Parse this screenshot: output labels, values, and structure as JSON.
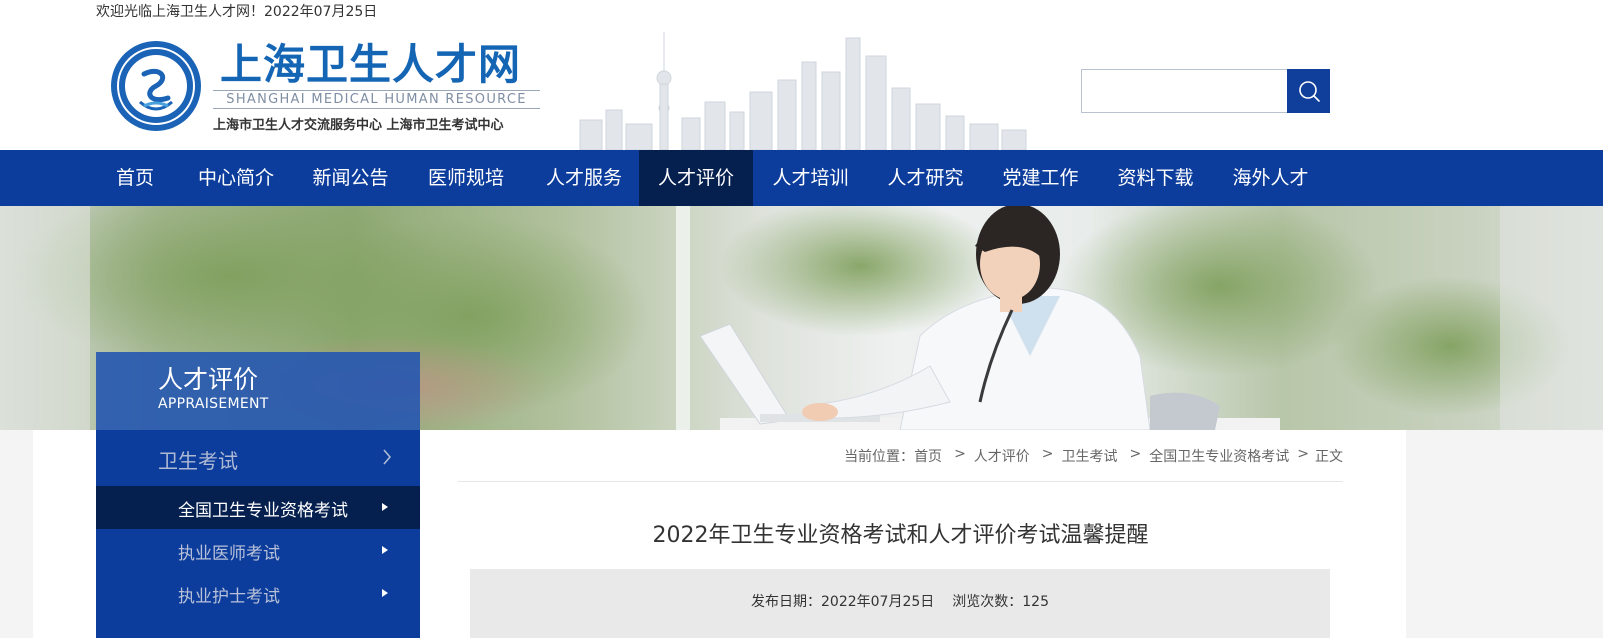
{
  "topbar": {
    "welcome": "欢迎光临上海卫生人才网！2022年07月25日"
  },
  "logo": {
    "title": "上海卫生人才网",
    "subtitle_en": "SHANGHAI MEDICAL HUMAN RESOURCE",
    "org": "上海市卫生人才交流服务中心  上海市卫生考试中心"
  },
  "search": {
    "placeholder": "",
    "value": ""
  },
  "nav": {
    "items": [
      {
        "label": "首页"
      },
      {
        "label": "中心简介"
      },
      {
        "label": "新闻公告"
      },
      {
        "label": "医师规培"
      },
      {
        "label": "人才服务"
      },
      {
        "label": "人才评价"
      },
      {
        "label": "人才培训"
      },
      {
        "label": "人才研究"
      },
      {
        "label": "党建工作"
      },
      {
        "label": "资料下载"
      },
      {
        "label": "海外人才"
      }
    ],
    "active": "人才评价"
  },
  "sidebar": {
    "title_cn": "人才评价",
    "title_en": "APPRAISEMENT",
    "category": "卫生考试",
    "subitems": [
      {
        "label": "全国卫生专业资格考试"
      },
      {
        "label": "执业医师考试"
      },
      {
        "label": "执业护士考试"
      }
    ]
  },
  "breadcrumb": {
    "prefix": "当前位置：",
    "items": [
      "首页",
      "人才评价",
      "卫生考试",
      "全国卫生专业资格考试",
      "正文"
    ],
    "separator": ">"
  },
  "article": {
    "title": "2022年卫生专业资格考试和人才评价考试温馨提醒",
    "publish_date": "发布日期：2022年07月25日",
    "views": "浏览次数：125"
  },
  "colors": {
    "nav_bg": "#0d3d9c",
    "nav_active": "#051f4f",
    "logo_blue": "#1565b5",
    "sidebar_head": "#2556b0"
  }
}
